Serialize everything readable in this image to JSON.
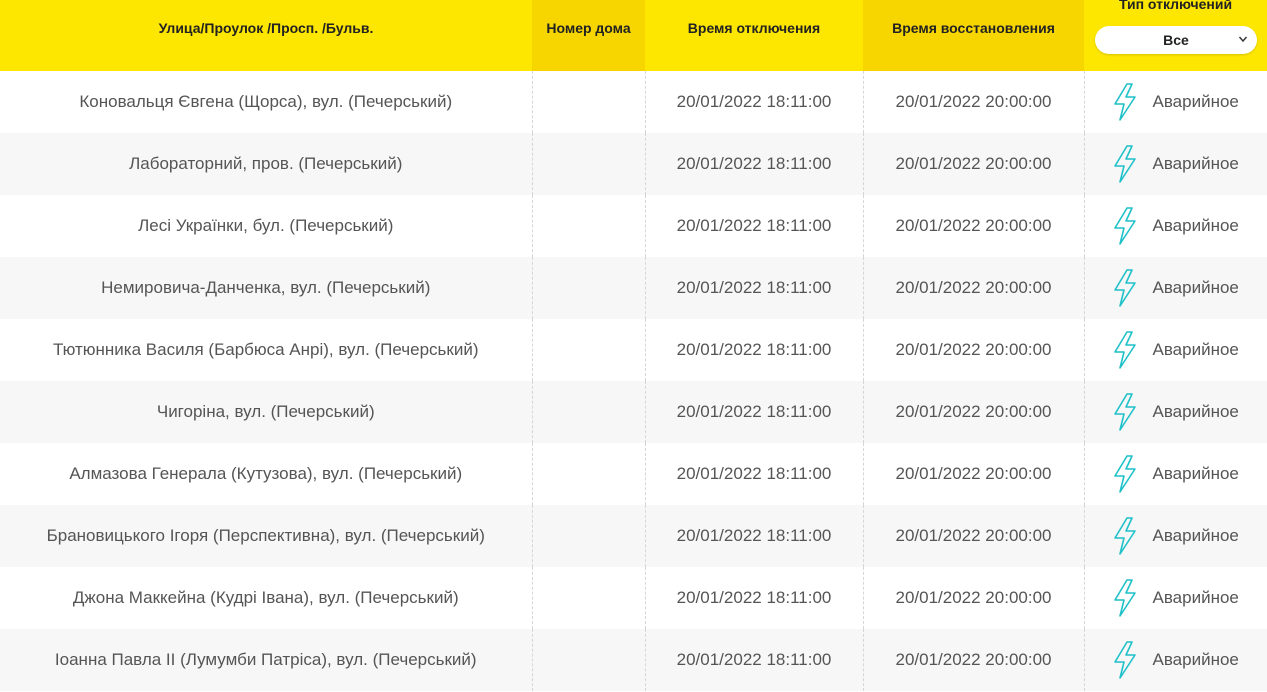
{
  "header": {
    "street": "Улица/Проулок /Просп. /Бульв.",
    "house": "Номер дома",
    "off_time": "Время отключения",
    "restore_time": "Время восстановления",
    "type": "Тип отключений",
    "filter_value": "Все"
  },
  "colors": {
    "header_yellow": "#fde600",
    "header_yellow_dark": "#f7d600",
    "bolt": "#1fc1c9",
    "row_alt": "#f7f7f7"
  },
  "rows": [
    {
      "street": "Коновальця Євгена (Щорса), вул. (Печерський)",
      "house": "",
      "off": "20/01/2022 18:11:00",
      "restore": "20/01/2022 20:00:00",
      "type": "Аварийное",
      "icon": "lightning-icon"
    },
    {
      "street": "Лабораторний, пров. (Печерський)",
      "house": "",
      "off": "20/01/2022 18:11:00",
      "restore": "20/01/2022 20:00:00",
      "type": "Аварийное",
      "icon": "lightning-icon"
    },
    {
      "street": "Лесі Українки, бул. (Печерський)",
      "house": "",
      "off": "20/01/2022 18:11:00",
      "restore": "20/01/2022 20:00:00",
      "type": "Аварийное",
      "icon": "lightning-icon"
    },
    {
      "street": "Немировича-Данченка, вул. (Печерський)",
      "house": "",
      "off": "20/01/2022 18:11:00",
      "restore": "20/01/2022 20:00:00",
      "type": "Аварийное",
      "icon": "lightning-icon"
    },
    {
      "street": "Тютюнника Василя (Барбюса Анрі), вул. (Печерський)",
      "house": "",
      "off": "20/01/2022 18:11:00",
      "restore": "20/01/2022 20:00:00",
      "type": "Аварийное",
      "icon": "lightning-icon"
    },
    {
      "street": "Чигоріна, вул. (Печерський)",
      "house": "",
      "off": "20/01/2022 18:11:00",
      "restore": "20/01/2022 20:00:00",
      "type": "Аварийное",
      "icon": "lightning-icon"
    },
    {
      "street": "Алмазова Генерала (Кутузова), вул. (Печерський)",
      "house": "",
      "off": "20/01/2022 18:11:00",
      "restore": "20/01/2022 20:00:00",
      "type": "Аварийное",
      "icon": "lightning-icon"
    },
    {
      "street": "Брановицького Ігоря (Перспективна), вул. (Печерський)",
      "house": "",
      "off": "20/01/2022 18:11:00",
      "restore": "20/01/2022 20:00:00",
      "type": "Аварийное",
      "icon": "lightning-icon"
    },
    {
      "street": "Джона Маккейна (Кудрі Івана), вул. (Печерський)",
      "house": "",
      "off": "20/01/2022 18:11:00",
      "restore": "20/01/2022 20:00:00",
      "type": "Аварийное",
      "icon": "lightning-icon"
    },
    {
      "street": "Іоанна Павла II (Лумумби Патріса), вул. (Печерський)",
      "house": "",
      "off": "20/01/2022 18:11:00",
      "restore": "20/01/2022 20:00:00",
      "type": "Аварийное",
      "icon": "lightning-icon"
    }
  ]
}
